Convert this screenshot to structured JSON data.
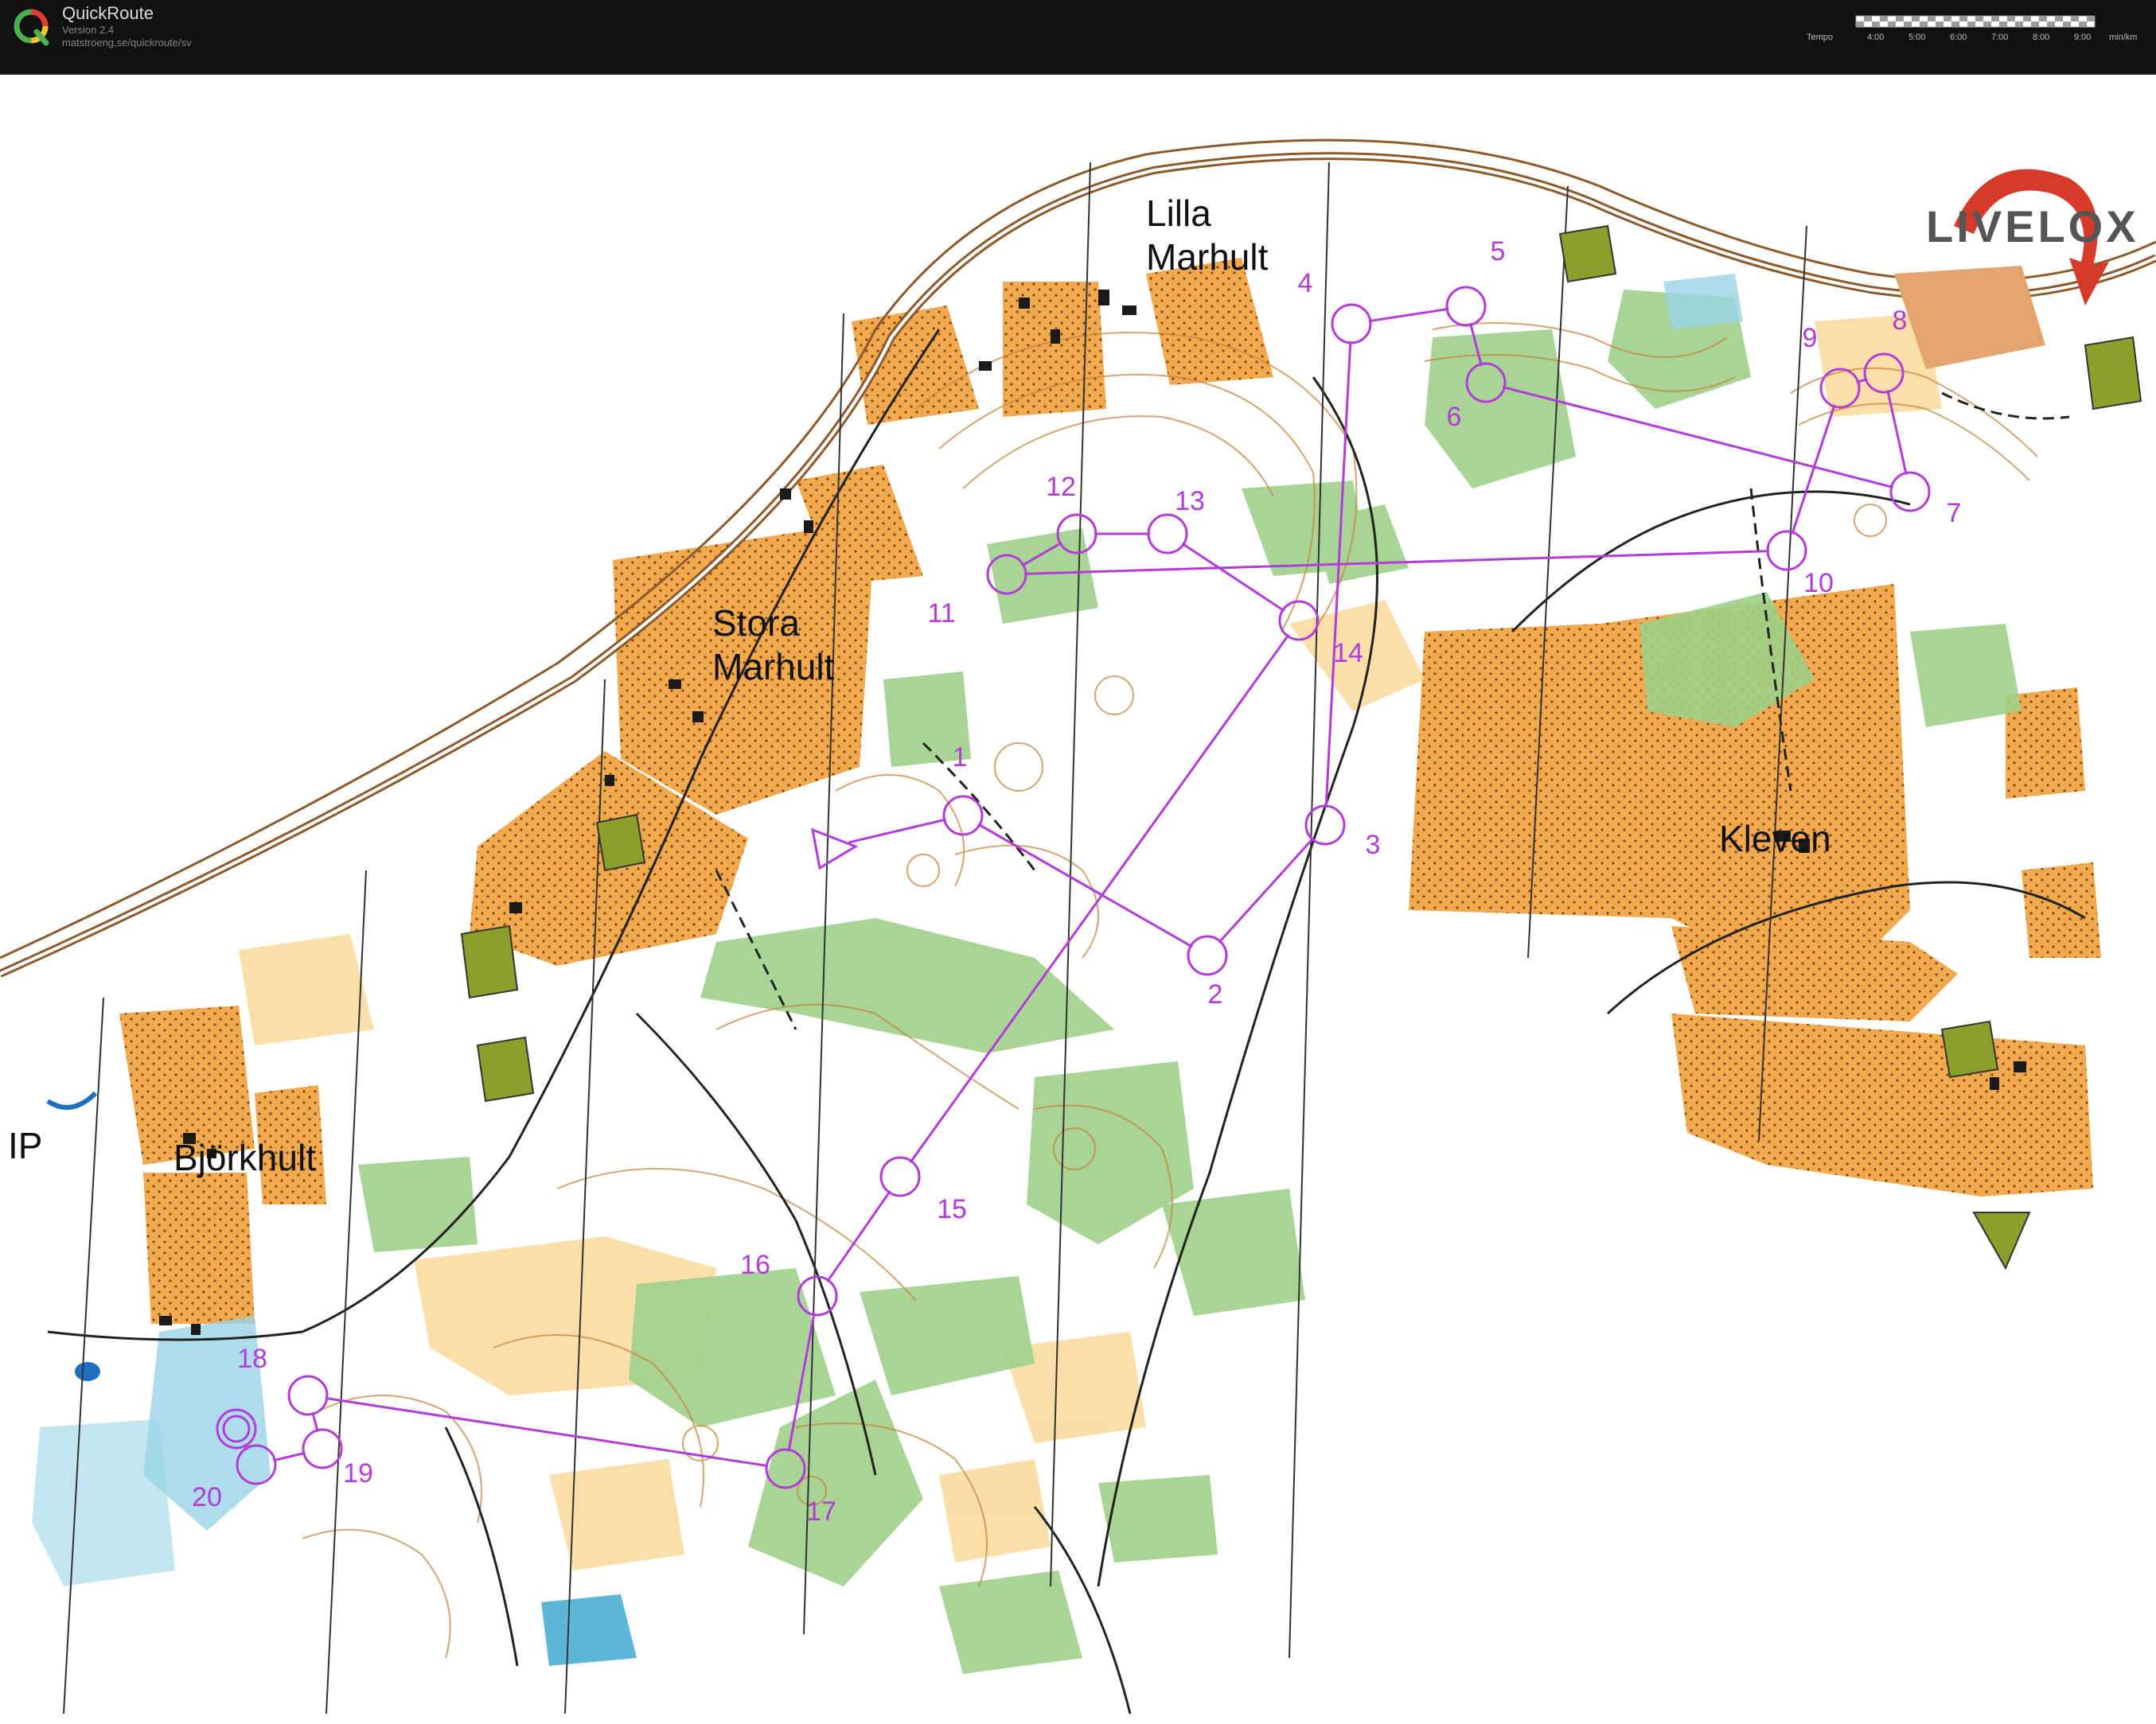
{
  "app": {
    "title": "QuickRoute",
    "version": "Version 2.4",
    "url": "matstroeng.se/quickroute/sv",
    "logo_letter": "Q",
    "logo_icon": "quickroute-q-icon"
  },
  "tempo": {
    "label": "Tempo",
    "ticks": [
      "4:00",
      "5:00",
      "6:00",
      "7:00",
      "8:00",
      "9:00"
    ],
    "unit": "min/km"
  },
  "map": {
    "watermark": "LIVELOX",
    "watermark_icon": "livelox-arrow-icon",
    "places": [
      "Lilla",
      "Marhult",
      "Stora",
      "Marhult",
      "Kleven",
      "Björkhult",
      "IP"
    ],
    "course_color": "#b13cd8",
    "colors": {
      "open_land": "#f2a94e",
      "forest_green": "#9fd08a",
      "building": "#1a1a1a",
      "contour": "#c7863f",
      "water": "#5bb6d8"
    },
    "controls": [
      {
        "label": "1"
      },
      {
        "label": "2"
      },
      {
        "label": "3"
      },
      {
        "label": "4"
      },
      {
        "label": "5"
      },
      {
        "label": "6"
      },
      {
        "label": "7"
      },
      {
        "label": "8"
      },
      {
        "label": "9"
      },
      {
        "label": "10"
      },
      {
        "label": "11"
      },
      {
        "label": "12"
      },
      {
        "label": "13"
      },
      {
        "label": "14"
      },
      {
        "label": "15"
      },
      {
        "label": "16"
      },
      {
        "label": "17"
      },
      {
        "label": "18"
      },
      {
        "label": "19"
      },
      {
        "label": "20"
      }
    ]
  }
}
